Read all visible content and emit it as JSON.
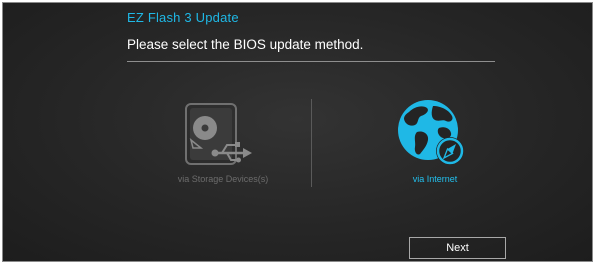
{
  "header": {
    "title": "EZ Flash 3 Update",
    "prompt": "Please select the BIOS update method."
  },
  "options": [
    {
      "label": "via Storage Devices(s)",
      "icon": "usb-storage-icon",
      "state": "disabled"
    },
    {
      "label": "via Internet",
      "icon": "globe-compass-icon",
      "state": "selected"
    }
  ],
  "footer": {
    "next_label": "Next"
  },
  "colors": {
    "accent": "#1fb8e6",
    "background": "#262626",
    "disabled_text": "#6c6c6c",
    "text": "#ffffff"
  }
}
